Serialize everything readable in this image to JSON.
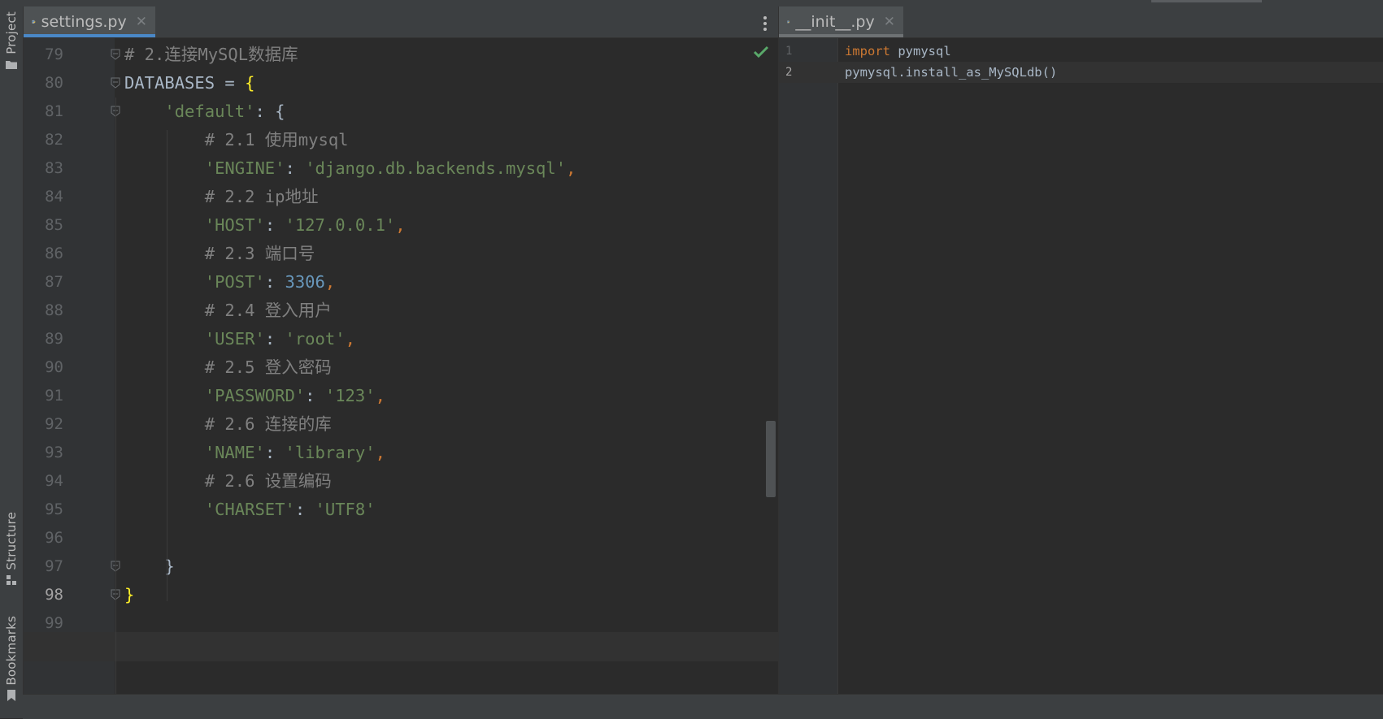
{
  "left_editor": {
    "tab_label": "settings.py",
    "lines": [
      {
        "n": "79",
        "tokens": [
          {
            "t": "# 2.连接MySQL数据库",
            "c": "com"
          }
        ]
      },
      {
        "n": "80",
        "tokens": [
          {
            "t": "DATABASES = ",
            "c": "plain"
          },
          {
            "t": "{",
            "c": "brace"
          }
        ]
      },
      {
        "n": "81",
        "tokens": [
          {
            "t": "    ",
            "c": "plain"
          },
          {
            "t": "'default'",
            "c": "str"
          },
          {
            "t": ": {",
            "c": "plain"
          }
        ]
      },
      {
        "n": "82",
        "tokens": [
          {
            "t": "        ",
            "c": "plain"
          },
          {
            "t": "# 2.1 使用mysql",
            "c": "com"
          }
        ]
      },
      {
        "n": "83",
        "tokens": [
          {
            "t": "        ",
            "c": "plain"
          },
          {
            "t": "'ENGINE'",
            "c": "str"
          },
          {
            "t": ": ",
            "c": "plain"
          },
          {
            "t": "'django.db.backends.mysql'",
            "c": "str"
          },
          {
            "t": ",",
            "c": "kw"
          }
        ]
      },
      {
        "n": "84",
        "tokens": [
          {
            "t": "        ",
            "c": "plain"
          },
          {
            "t": "# 2.2 ip地址",
            "c": "com"
          }
        ]
      },
      {
        "n": "85",
        "tokens": [
          {
            "t": "        ",
            "c": "plain"
          },
          {
            "t": "'HOST'",
            "c": "str"
          },
          {
            "t": ": ",
            "c": "plain"
          },
          {
            "t": "'127.0.0.1'",
            "c": "str"
          },
          {
            "t": ",",
            "c": "kw"
          }
        ]
      },
      {
        "n": "86",
        "tokens": [
          {
            "t": "        ",
            "c": "plain"
          },
          {
            "t": "# 2.3 端口号",
            "c": "com"
          }
        ]
      },
      {
        "n": "87",
        "tokens": [
          {
            "t": "        ",
            "c": "plain"
          },
          {
            "t": "'POST'",
            "c": "str"
          },
          {
            "t": ": ",
            "c": "plain"
          },
          {
            "t": "3306",
            "c": "num"
          },
          {
            "t": ",",
            "c": "kw"
          }
        ]
      },
      {
        "n": "88",
        "tokens": [
          {
            "t": "        ",
            "c": "plain"
          },
          {
            "t": "# 2.4 登入用户",
            "c": "com"
          }
        ]
      },
      {
        "n": "89",
        "tokens": [
          {
            "t": "        ",
            "c": "plain"
          },
          {
            "t": "'USER'",
            "c": "str"
          },
          {
            "t": ": ",
            "c": "plain"
          },
          {
            "t": "'root'",
            "c": "str"
          },
          {
            "t": ",",
            "c": "kw"
          }
        ]
      },
      {
        "n": "90",
        "tokens": [
          {
            "t": "        ",
            "c": "plain"
          },
          {
            "t": "# 2.5 登入密码",
            "c": "com"
          }
        ]
      },
      {
        "n": "91",
        "tokens": [
          {
            "t": "        ",
            "c": "plain"
          },
          {
            "t": "'PASSWORD'",
            "c": "str"
          },
          {
            "t": ": ",
            "c": "plain"
          },
          {
            "t": "'123'",
            "c": "str"
          },
          {
            "t": ",",
            "c": "kw"
          }
        ]
      },
      {
        "n": "92",
        "tokens": [
          {
            "t": "        ",
            "c": "plain"
          },
          {
            "t": "# 2.6 连接的库",
            "c": "com"
          }
        ]
      },
      {
        "n": "93",
        "tokens": [
          {
            "t": "        ",
            "c": "plain"
          },
          {
            "t": "'NAME'",
            "c": "str"
          },
          {
            "t": ": ",
            "c": "plain"
          },
          {
            "t": "'library'",
            "c": "str"
          },
          {
            "t": ",",
            "c": "kw"
          }
        ]
      },
      {
        "n": "94",
        "tokens": [
          {
            "t": "        ",
            "c": "plain"
          },
          {
            "t": "# 2.6 设置编码",
            "c": "com"
          }
        ]
      },
      {
        "n": "95",
        "tokens": [
          {
            "t": "        ",
            "c": "plain"
          },
          {
            "t": "'CHARSET'",
            "c": "str"
          },
          {
            "t": ": ",
            "c": "plain"
          },
          {
            "t": "'UTF8'",
            "c": "str"
          }
        ]
      },
      {
        "n": "96",
        "tokens": []
      },
      {
        "n": "97",
        "tokens": [
          {
            "t": "    }",
            "c": "plain"
          }
        ]
      },
      {
        "n": "98",
        "tokens": [
          {
            "t": "}",
            "c": "brace"
          }
        ],
        "current": true
      },
      {
        "n": "99",
        "tokens": []
      }
    ]
  },
  "right_editor": {
    "tab_label": "__init__.py",
    "lines": [
      {
        "n": "1",
        "tokens": [
          {
            "t": "import",
            "c": "kw"
          },
          {
            "t": " pymysql",
            "c": "plain"
          }
        ]
      },
      {
        "n": "2",
        "tokens": [
          {
            "t": "pymysql.install_as_MySQLdb()",
            "c": "plain"
          }
        ],
        "current": true
      }
    ]
  },
  "tool_windows": {
    "project": "Project",
    "structure": "Structure",
    "bookmarks": "Bookmarks"
  },
  "icons": {
    "python_file": "python-file-icon",
    "check": "check-icon",
    "more": "more-vert-icon"
  },
  "colors": {
    "background": "#2b2b2b",
    "keyword": "#cc7832",
    "string": "#6a8759",
    "number": "#6897bb",
    "comment": "#808080",
    "active_tab_underline": "#4a88c7",
    "check": "#59a869"
  }
}
